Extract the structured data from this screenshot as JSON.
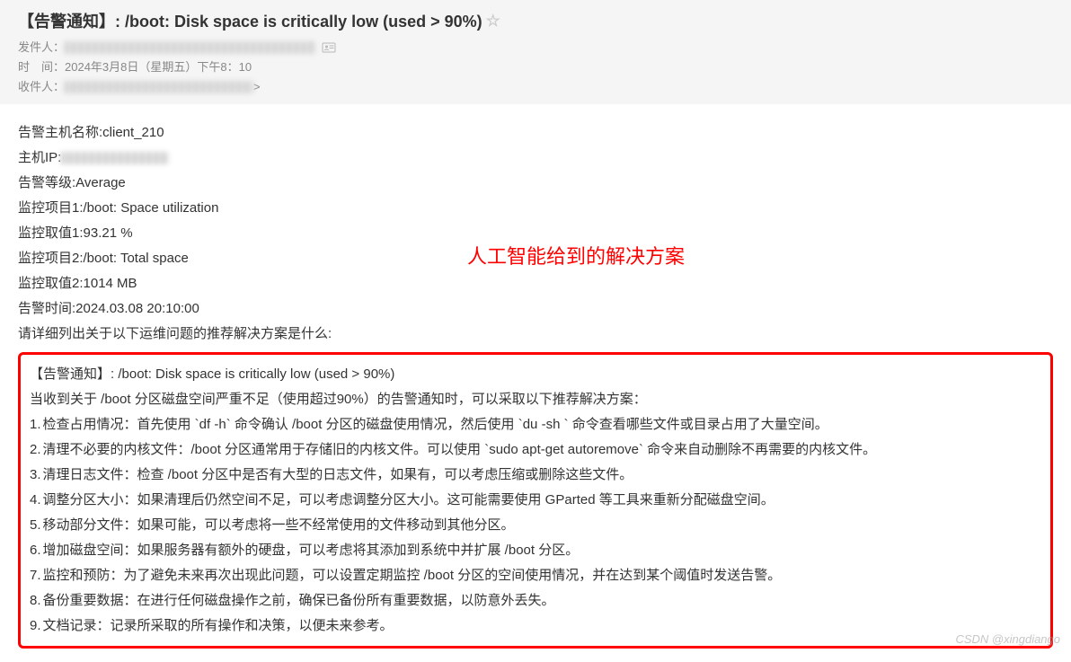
{
  "header": {
    "subject": "【告警通知】: /boot: Disk space is critically low (used > 90%)",
    "sender_label": "发件人：",
    "time_label": "时　间：",
    "time_value": "2024年3月8日（星期五）下午8：10",
    "recipient_label": "收件人：",
    "recipient_suffix": ">"
  },
  "body": {
    "host_name_label": "告警主机名称: ",
    "host_name_value": "client_210",
    "host_ip_label": "主机IP:",
    "alert_level_label": "告警等级: ",
    "alert_level_value": "Average",
    "item1_label": "监控项目1:",
    "item1_value": "/boot: Space utilization",
    "value1_label": "监控取值1:",
    "value1_value": "93.21 %",
    "item2_label": "监控项目2:",
    "item2_value": "/boot: Total space",
    "value2_label": "监控取值2:",
    "value2_value": "1014 MB",
    "alert_time_label": "告警时间:",
    "alert_time_value": "2024.03.08 20:10:00",
    "prompt_line": "请详细列出关于以下运维问题的推荐解决方案是什么:"
  },
  "annotation": "人工智能给到的解决方案",
  "solution": {
    "title": "【告警通知】: /boot: Disk space is critically low (used > 90%)",
    "intro": "当收到关于 /boot 分区磁盘空间严重不足（使用超过90%）的告警通知时，可以采取以下推荐解决方案：",
    "items": [
      "检查占用情况：首先使用 `df -h` 命令确认 /boot 分区的磁盘使用情况，然后使用 `du -sh ` 命令查看哪些文件或目录占用了大量空间。",
      "清理不必要的内核文件：/boot 分区通常用于存储旧的内核文件。可以使用 `sudo apt-get autoremove` 命令来自动删除不再需要的内核文件。",
      "清理日志文件：检查 /boot 分区中是否有大型的日志文件，如果有，可以考虑压缩或删除这些文件。",
      "调整分区大小：如果清理后仍然空间不足，可以考虑调整分区大小。这可能需要使用 GParted 等工具来重新分配磁盘空间。",
      "移动部分文件：如果可能，可以考虑将一些不经常使用的文件移动到其他分区。",
      "增加磁盘空间：如果服务器有额外的硬盘，可以考虑将其添加到系统中并扩展 /boot 分区。",
      "监控和预防：为了避免未来再次出现此问题，可以设置定期监控 /boot 分区的空间使用情况，并在达到某个阈值时发送告警。",
      "备份重要数据：在进行任何磁盘操作之前，确保已备份所有重要数据，以防意外丢失。",
      "文档记录：记录所采取的所有操作和决策，以便未来参考。"
    ]
  },
  "watermark": "CSDN @xingdiango"
}
